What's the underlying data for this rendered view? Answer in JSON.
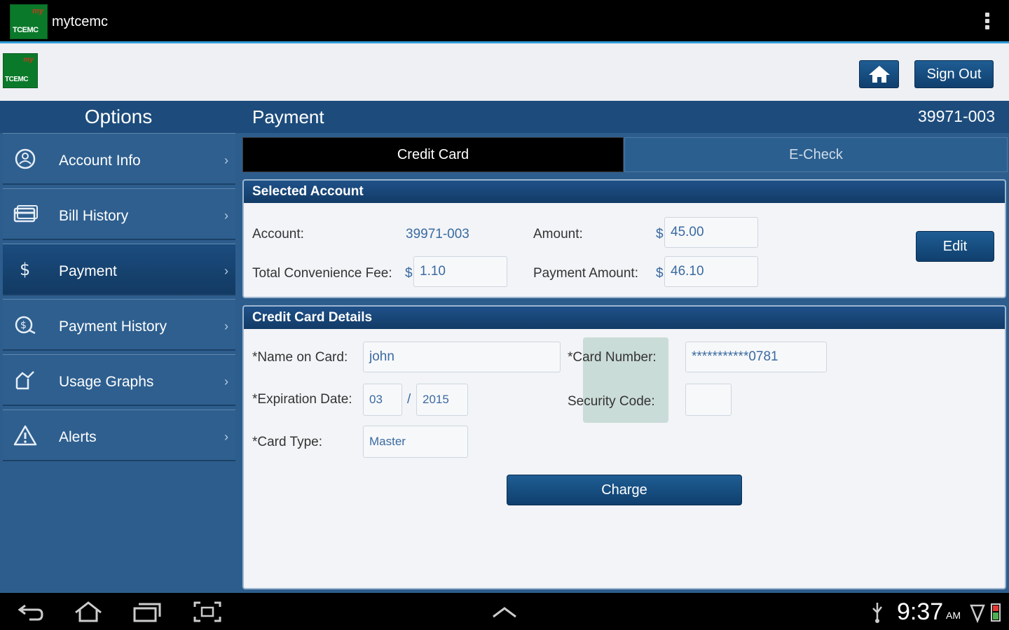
{
  "app": {
    "title": "mytcemc",
    "logo_small": "my",
    "logo_text": "TCEMC"
  },
  "header": {
    "home_icon": "home-icon",
    "signout_label": "Sign Out"
  },
  "sidebar": {
    "title": "Options",
    "items": [
      {
        "label": "Account Info",
        "icon": "account-icon",
        "active": false
      },
      {
        "label": "Bill History",
        "icon": "bill-icon",
        "active": false
      },
      {
        "label": "Payment",
        "icon": "dollar-icon",
        "active": true
      },
      {
        "label": "Payment History",
        "icon": "payment-history-icon",
        "active": false
      },
      {
        "label": "Usage Graphs",
        "icon": "usage-graph-icon",
        "active": false
      },
      {
        "label": "Alerts",
        "icon": "alert-icon",
        "active": false
      }
    ]
  },
  "content": {
    "title": "Payment",
    "account_number": "39971-003",
    "tabs": {
      "credit": "Credit Card",
      "echeck": "E-Check"
    },
    "selected_account": {
      "heading": "Selected Account",
      "account_label": "Account:",
      "account_value": "39971-003",
      "amount_label": "Amount:",
      "amount_currency": "$",
      "amount_value": "45.00",
      "fee_label": "Total Convenience Fee:",
      "fee_currency": "$",
      "fee_value": "1.10",
      "payment_amount_label": "Payment Amount:",
      "payment_amount_currency": "$",
      "payment_amount_value": "46.10",
      "edit_label": "Edit"
    },
    "card_details": {
      "heading": "Credit Card Details",
      "name_label": "*Name on Card:",
      "name_value": "john",
      "card_number_label": "*Card Number:",
      "card_number_value": "***********0781",
      "expiration_label": "*Expiration Date:",
      "exp_month": "03",
      "exp_sep": "/",
      "exp_year": "2015",
      "security_label": "Security Code:",
      "security_value": "",
      "card_type_label": "*Card Type:",
      "card_type_value": "Master",
      "charge_label": "Charge"
    }
  },
  "system": {
    "time": "9:37",
    "ampm": "AM"
  }
}
